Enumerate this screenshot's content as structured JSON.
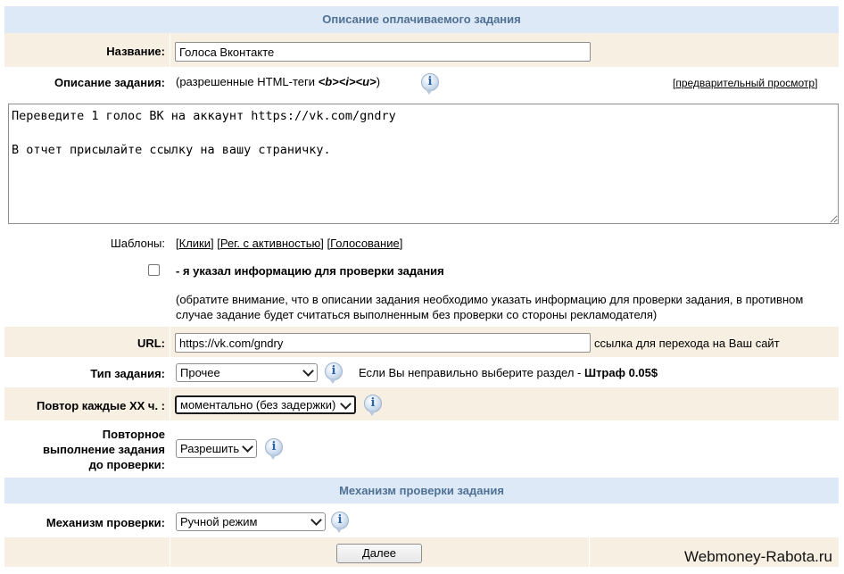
{
  "sections": {
    "task_description": "Описание оплачиваемого задания",
    "check_mechanism": "Механизм проверки задания"
  },
  "title_field": {
    "label": "Название:",
    "value": "Голоса Вконтакте"
  },
  "description": {
    "label": "Описание задания:",
    "hint_prefix": "(разрешенные HTML-теги ",
    "hint_tags": "<b><i><u>",
    "hint_suffix": ")",
    "preview_open": "[",
    "preview_link": "предварительный просмотр",
    "preview_close": "]",
    "text": "Переведите 1 голос ВК на аккаунт https://vk.com/gndry\n\nВ отчет присылайте ссылку на вашу страничку."
  },
  "templates": {
    "label": "Шаблоны:",
    "items": [
      "Клики",
      "Рег. с активностью",
      "Голосование"
    ]
  },
  "verification_info": {
    "checkbox_label": "- я указал информацию для проверки задания",
    "note": "(обратите внимание, что в описании задания необходимо указать информацию для проверки задания, в противном случае задание будет считаться выполненным без проверки со стороны рекламодателя)"
  },
  "url_field": {
    "label": "URL:",
    "value": "https://vk.com/gndry",
    "hint": "ссылка для перехода на Ваш сайт"
  },
  "task_type": {
    "label": "Тип задания:",
    "selected": "Прочее",
    "warning": "Если Вы неправильно выберите раздел - ",
    "penalty": "Штраф 0.05$"
  },
  "repeat": {
    "label": "Повтор каждые XX ч. :",
    "selected": "моментально (без задержки)"
  },
  "repeat_before_check": {
    "label_lines": [
      "Повторное",
      "выполнение задания",
      "до проверки:"
    ],
    "selected": "Разрешить"
  },
  "mechanism": {
    "label": "Механизм проверки:",
    "selected": "Ручной режим"
  },
  "next_button": "Далее",
  "watermark": "Webmoney-Rabota.ru",
  "info_glyph": "i",
  "icons": {
    "info": "info-bubble-icon",
    "dropdown": "chevron-down-icon",
    "resize": "resize-grip-icon"
  }
}
